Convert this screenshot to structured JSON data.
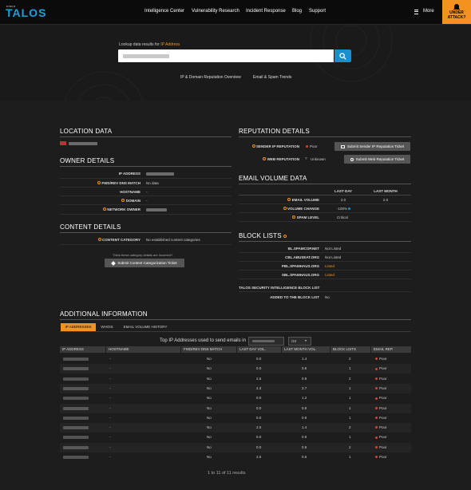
{
  "header": {
    "logo_top": "cisco",
    "logo": "TALOS",
    "nav": [
      "Intelligence Center",
      "Vulnerability Research",
      "Incident Response",
      "Blog",
      "Support"
    ],
    "more": "More",
    "under_attack_1": "UNDER",
    "under_attack_2": "ATTACK?"
  },
  "hero": {
    "lookup_prefix": "Lookup data results for",
    "lookup_type": "IP Address",
    "links": [
      "IP & Domain Reputation Overview",
      "Email & Spam Trends"
    ]
  },
  "location": {
    "title": "LOCATION DATA"
  },
  "owner": {
    "title": "OWNER DETAILS",
    "rows": [
      {
        "label": "IP ADDRESS",
        "value": ""
      },
      {
        "label": "FWD/REV DNS MATCH",
        "value": "No data"
      },
      {
        "label": "HOSTNAME",
        "value": "-"
      },
      {
        "label": "DOMAIN",
        "value": "-"
      },
      {
        "label": "NETWORK OWNER",
        "value": ""
      }
    ]
  },
  "content": {
    "title": "CONTENT DETAILS",
    "category_label": "CONTENT CATEGORY",
    "category_value": "No established content categories",
    "question": "Think these category details are incorrect?",
    "button": "Submit Content Categorization Ticket"
  },
  "reputation": {
    "title": "REPUTATION DETAILS",
    "sender_label": "SENDER IP REPUTATION",
    "sender_value": "Poor",
    "sender_button": "Submit Sender IP Reputation Ticket",
    "web_label": "WEB REPUTATION",
    "web_value": "Unknown",
    "web_button": "Submit Web Reputation Ticket"
  },
  "email_volume": {
    "title": "EMAIL VOLUME DATA",
    "col_last_day": "LAST DAY",
    "col_last_month": "LAST MONTH",
    "rows": [
      {
        "label": "EMAIL VOLUME",
        "last_day": "2.0",
        "last_month": "2.0"
      },
      {
        "label": "VOLUME CHANGE",
        "last_day": "-100%",
        "last_month": ""
      },
      {
        "label": "SPAM LEVEL",
        "last_day": "Critical",
        "last_month": ""
      }
    ]
  },
  "block_lists": {
    "title": "BLOCK LISTS",
    "rows": [
      {
        "label": "BL.SPAMCOP.NET",
        "value": "Not Listed",
        "listed": false
      },
      {
        "label": "CBL.ABUSEAT.ORG",
        "value": "Not Listed",
        "listed": false
      },
      {
        "label": "PBL.SPAMHAUS.ORG",
        "value": "Listed",
        "listed": true
      },
      {
        "label": "SBL.SPAMHAUS.ORG",
        "value": "Listed",
        "listed": true
      }
    ],
    "talos_title": "TALOS SECURITY INTELLIGENCE BLOCK LIST",
    "added_label": "ADDED TO THE BLOCK LIST",
    "added_value": "No"
  },
  "additional": {
    "title": "ADDITIONAL INFORMATION",
    "tabs": [
      "IP ADDRESSES",
      "WHOIS",
      "EMAIL VOLUME HISTORY"
    ],
    "top_text": "Top IP Addresses used to send emails in",
    "subnet": "/24",
    "columns": [
      "IP ADDRESS",
      "HOSTNAME",
      "FWD/REV DNS MATCH",
      "LAST DAY VOL.",
      "LAST MONTH VOL.",
      "BLOCK LISTS",
      "EMAIL REP."
    ],
    "rows": [
      {
        "hostname": "-",
        "dns": "No",
        "day": "0.0",
        "month": "1.4",
        "bl": "2",
        "rep": "Poor"
      },
      {
        "hostname": "-",
        "dns": "No",
        "day": "0.0",
        "month": "0.6",
        "bl": "1",
        "rep": "Poor"
      },
      {
        "hostname": "-",
        "dns": "No",
        "day": "2.5",
        "month": "0.9",
        "bl": "2",
        "rep": "Poor"
      },
      {
        "hostname": "-",
        "dns": "No",
        "day": "4.3",
        "month": "2.7",
        "bl": "1",
        "rep": "Poor"
      },
      {
        "hostname": "-",
        "dns": "No",
        "day": "0.0",
        "month": "1.2",
        "bl": "1",
        "rep": "Poor"
      },
      {
        "hostname": "-",
        "dns": "No",
        "day": "0.0",
        "month": "0.9",
        "bl": "1",
        "rep": "Poor"
      },
      {
        "hostname": "-",
        "dns": "No",
        "day": "0.0",
        "month": "0.9",
        "bl": "1",
        "rep": "Poor"
      },
      {
        "hostname": "-",
        "dns": "No",
        "day": "2.5",
        "month": "1.4",
        "bl": "2",
        "rep": "Poor"
      },
      {
        "hostname": "-",
        "dns": "No",
        "day": "0.0",
        "month": "0.9",
        "bl": "1",
        "rep": "Poor"
      },
      {
        "hostname": "-",
        "dns": "No",
        "day": "0.0",
        "month": "0.9",
        "bl": "2",
        "rep": "Poor"
      },
      {
        "hostname": "-",
        "dns": "No",
        "day": "2.5",
        "month": "0.6",
        "bl": "1",
        "rep": "Poor"
      }
    ],
    "pagination": "1 to 11 of 11 results"
  }
}
